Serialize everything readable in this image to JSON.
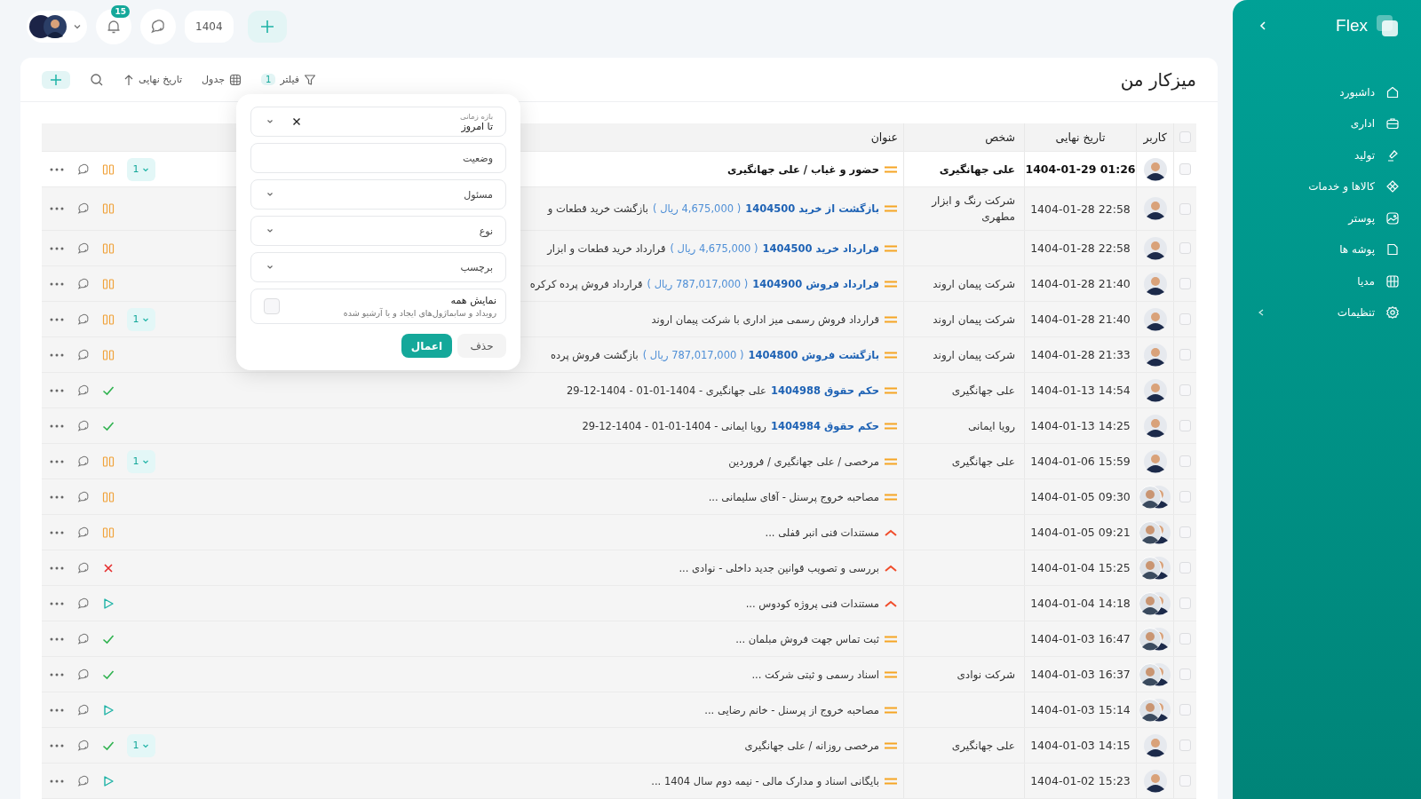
{
  "topbar": {
    "notifications": "15",
    "year": "1404"
  },
  "page": {
    "title": "میزکار من"
  },
  "toolbar": {
    "filter_label": "فیلتر",
    "filter_count": "1",
    "view": "جدول",
    "sort": "تاریخ نهایی"
  },
  "table": {
    "columns": [
      "کاربر",
      "تاریخ نهایی",
      "شخص",
      "عنوان"
    ],
    "all_checked": false,
    "rows": [
      {
        "checked": false,
        "unread": true,
        "shared": false,
        "date": "1404-01-29 01:26",
        "person": "علی جهانگیری",
        "urgent": false,
        "title": "حضور و غیاب / علی جهانگیری",
        "kind": "paused",
        "subtasks": "1"
      },
      {
        "checked": false,
        "unread": false,
        "shared": false,
        "date": "1404-01-28 22:58",
        "person": "شرکت رنگ و ابزار مطهری",
        "urgent": false,
        "link": "بازگشت از خرید 1404500",
        "amount": "( 4,675,000 ریال )",
        "title": "بازگشت خرید قطعات و",
        "kind": "paused"
      },
      {
        "checked": false,
        "unread": false,
        "shared": false,
        "date": "1404-01-28 22:58",
        "urgent": false,
        "link": "قرارداد خرید 1404500",
        "amount": "( 4,675,000 ریال )",
        "title": "قرارداد خرید قطعات و ابزار",
        "kind": "paused"
      },
      {
        "checked": false,
        "unread": false,
        "shared": false,
        "date": "1404-01-28 21:40",
        "person": "شرکت پیمان اروند",
        "urgent": false,
        "link": "قرارداد فروش 1404900",
        "amount": "( 787,017,000 ریال )",
        "title": "قرارداد فروش پرده کرکره",
        "kind": "paused"
      },
      {
        "checked": false,
        "unread": false,
        "shared": false,
        "date": "1404-01-28 21:40",
        "person": "شرکت پیمان اروند",
        "urgent": false,
        "title": "قرارداد فروش رسمی میز اداری با شرکت پیمان اروند",
        "kind": "paused",
        "subtasks": "1"
      },
      {
        "checked": false,
        "unread": false,
        "shared": false,
        "date": "1404-01-28 21:33",
        "person": "شرکت پیمان اروند",
        "urgent": false,
        "link": "بازگشت فروش 1404800",
        "amount": "( 787,017,000 ریال )",
        "title": "بازگشت فروش پرده",
        "kind": "paused"
      },
      {
        "checked": false,
        "unread": false,
        "shared": false,
        "date": "1404-01-13 14:54",
        "person": "علی جهانگیری",
        "urgent": false,
        "link": "حکم حقوق 1404988",
        "title": "علی جهانگیری - 1404-01-01 - 1404-12-29",
        "kind": "done"
      },
      {
        "checked": false,
        "unread": false,
        "shared": false,
        "date": "1404-01-13 14:25",
        "person": "رویا ایمانی",
        "urgent": false,
        "link": "حکم حقوق 1404984",
        "title": "رویا ایمانی - 1404-01-01 - 1404-12-29",
        "kind": "done"
      },
      {
        "checked": false,
        "unread": false,
        "shared": false,
        "date": "1404-01-06 15:59",
        "person": "علی جهانگیری",
        "urgent": false,
        "title": "مرخصی / علی جهانگیری / فروردین",
        "kind": "paused",
        "subtasks": "1"
      },
      {
        "checked": false,
        "unread": false,
        "shared": true,
        "date": "1404-01-05 09:30",
        "urgent": false,
        "title": "مصاحبه خروج پرسنل - آقای سلیمانی ...",
        "kind": "paused"
      },
      {
        "checked": false,
        "unread": false,
        "shared": true,
        "date": "1404-01-05 09:21",
        "urgent": true,
        "title": "مستندات فنی انبر قفلی ...",
        "kind": "paused"
      },
      {
        "checked": false,
        "unread": false,
        "shared": true,
        "date": "1404-01-04 15:25",
        "urgent": true,
        "title": "بررسی و تصویب قوانین جدید داخلی - نوادی ...",
        "kind": "canceled"
      },
      {
        "checked": false,
        "unread": false,
        "shared": true,
        "date": "1404-01-04 14:18",
        "urgent": true,
        "title": "مستندات فنی پروژه کودوس ...",
        "kind": "started"
      },
      {
        "checked": false,
        "unread": false,
        "shared": true,
        "date": "1404-01-03 16:47",
        "urgent": false,
        "title": "ثبت تماس جهت فروش مبلمان ...",
        "kind": "done"
      },
      {
        "checked": false,
        "unread": false,
        "shared": true,
        "date": "1404-01-03 16:37",
        "person": "شرکت نوادی",
        "urgent": false,
        "title": "اسناد رسمی و ثبتی شرکت ...",
        "kind": "done"
      },
      {
        "checked": false,
        "unread": false,
        "shared": true,
        "date": "1404-01-03 15:14",
        "urgent": false,
        "title": "مصاحبه خروج از پرسنل - خانم رضایی ...",
        "kind": "started"
      },
      {
        "checked": false,
        "unread": false,
        "shared": false,
        "date": "1404-01-03 14:15",
        "person": "علی جهانگیری",
        "urgent": false,
        "title": "مرخصی روزانه / علی جهانگیری",
        "kind": "done",
        "subtasks": "1"
      },
      {
        "checked": false,
        "unread": false,
        "shared": false,
        "date": "1404-01-02 15:23",
        "urgent": false,
        "title": "بایگانی اسناد و مدارک مالی - نیمه دوم سال 1404 ...",
        "kind": "started"
      }
    ]
  },
  "filter_panel": {
    "fields": [
      {
        "kind": "select",
        "label": "بازه زمانی",
        "value": "تا امروز",
        "clearable": true
      },
      {
        "kind": "text",
        "placeholder": "وضعیت"
      },
      {
        "kind": "select",
        "placeholder": "مسئول"
      },
      {
        "kind": "select",
        "placeholder": "نوع"
      },
      {
        "kind": "select",
        "placeholder": "برچسب"
      }
    ],
    "show_all": {
      "label": "نمایش همه",
      "hint": "رویداد و سابماژول‌های ایجاد و یا آرشیو شده",
      "checked": false
    },
    "apply": "اعمال",
    "remove": "حذف"
  },
  "sidebar": {
    "logo": "Flex",
    "items": [
      {
        "label": "داشبورد"
      },
      {
        "label": "اداری"
      },
      {
        "label": "تولید"
      },
      {
        "label": "کالاها و خدمات"
      },
      {
        "label": "پوستر"
      },
      {
        "label": "پوشه ها"
      },
      {
        "label": "مدیا"
      },
      {
        "label": "تنظیمات",
        "expanded": false
      }
    ]
  }
}
